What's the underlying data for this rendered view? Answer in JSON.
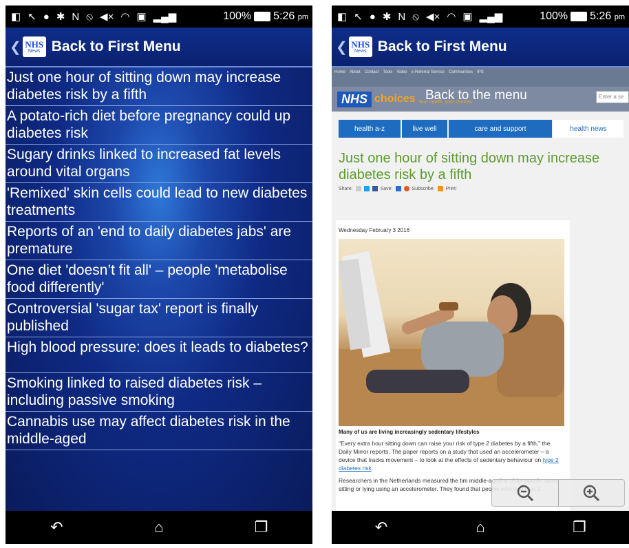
{
  "status": {
    "battery": "100%",
    "time": "5:26",
    "ampm": "pm"
  },
  "left_screen": {
    "title": "Back to First Menu",
    "logo_text": "NHS",
    "logo_sub": "News",
    "news_items": [
      "Just one hour of sitting down may increase diabetes risk by a fifth",
      "A potato-rich diet before pregnancy could up diabetes risk",
      "Sugary drinks linked to increased fat levels around vital organs",
      "'Remixed' skin cells could lead to new diabetes treatments",
      "Reports of an 'end to daily diabetes jabs' are premature",
      "One diet 'doesn’t fit all' – people 'metabolise food differently'",
      "Controversial 'sugar tax' report is finally published",
      "High blood pressure: does it leads to diabetes?",
      "Smoking linked to raised diabetes risk – including passive smoking",
      "Cannabis use may affect diabetes risk in the middle-aged"
    ]
  },
  "right_screen": {
    "title": "Back to First Menu",
    "logo_text": "NHS",
    "logo_sub": "News",
    "web": {
      "top_links": [
        "Home",
        "About",
        "Contact",
        "Tools",
        "Video",
        "e-Referral Service",
        "Communities",
        "IPS"
      ],
      "brand": "NHS",
      "choices": "choices",
      "tagline": "Your health, your choices",
      "back_to_menu": "Back to the menu",
      "search_placeholder": "Enter a se",
      "tabs": [
        "health a-z",
        "live well",
        "care and support",
        "health news"
      ],
      "article_title": "Just one hour of sitting down may increase diabetes risk by a fifth",
      "share_label": "Share:",
      "save_label": "Save:",
      "subscribe_label": "Subscribe:",
      "print_label": "Print:",
      "date": "Wednesday February 3 2016",
      "caption": "Many of us are living increasingly sedentary lifestyles",
      "para1": "\"Every extra hour sitting down can raise your risk of type 2 diabetes by a fifth,\" the Daily Mirror reports. The paper reports on a study that used an accelerometer – a device that tracks movement – to look at the effects of sedentary behaviour on",
      "para1_link": "type 2 diabetes risk",
      "para2": "Researchers in the Netherlands measured the tim middle-aged or older people spent sitting or lying using an accelerometer. They found that people who had type 2"
    }
  },
  "colors": {
    "app_bar": "#0e2e8a",
    "list_bg_center": "#2f78d8",
    "list_bg_edge": "#0a1b5c",
    "nhs_green": "#5b9c2e",
    "nhs_blue": "#1e6cc0"
  },
  "icons": [
    "back-chevron-icon",
    "nhs-news-logo",
    "back-nav-icon",
    "home-nav-icon",
    "recents-nav-icon",
    "zoom-out-icon",
    "zoom-in-icon"
  ]
}
